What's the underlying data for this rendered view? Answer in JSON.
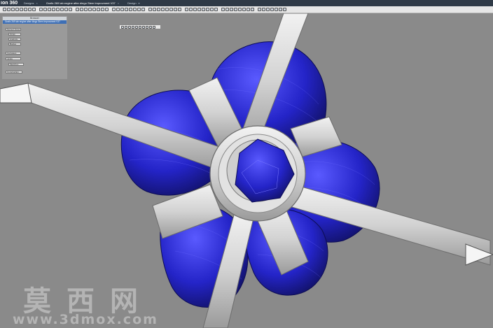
{
  "titlebar": {
    "app_title": "ion 360",
    "tabs": [
      {
        "label": "Designs",
        "active": false
      },
      {
        "label": "Grafic 269 lab engine after diego Stem Improvment V37",
        "active": true
      },
      {
        "label": "Design",
        "active": false
      }
    ]
  },
  "browser": {
    "header": "Browser",
    "document": "Grafic 269 lab engine after diego Stem Improvment V37",
    "nodes": [
      "Named Views",
      "Origin",
      "Analysis",
      "Bodies",
      "Canvases",
      "Joints",
      "Sketches",
      "Construction"
    ]
  },
  "colors": {
    "background": "#8a8a8a",
    "accent_blue": "#2b2bd2",
    "metal": "#d9d9d9"
  },
  "watermark": {
    "cn": "莫西网",
    "url": "www.3dmox.com"
  }
}
